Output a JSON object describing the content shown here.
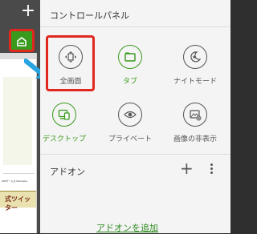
{
  "header": {
    "title": "コントロールパネル"
  },
  "toolbar": {
    "new_tab_symbol": "+"
  },
  "grid": {
    "items": [
      {
        "label": "全画面",
        "icon": "fullscreen-icon",
        "active": false
      },
      {
        "label": "タブ",
        "icon": "tabs-icon",
        "active": true
      },
      {
        "label": "ナイトモード",
        "icon": "night-mode-icon",
        "active": false
      },
      {
        "label": "デスクトップ",
        "icon": "desktop-icon",
        "active": true
      },
      {
        "label": "プライベート",
        "icon": "private-icon",
        "active": false
      },
      {
        "label": "画像の非表示",
        "icon": "hide-images-icon",
        "active": false
      }
    ]
  },
  "addons": {
    "title": "アドオン",
    "plus": "+",
    "add_link": "アドオンを追加"
  },
  "background_page": {
    "snippet": "WMゲームズ Memplus",
    "banner_text": "式ツイッター"
  },
  "colors": {
    "accent": "#3a9a1d",
    "highlight": "#e0281e",
    "panel_bg": "#f4f4f4"
  }
}
